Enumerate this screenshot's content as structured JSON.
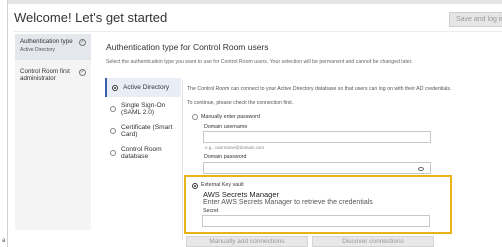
{
  "page": {
    "title": "Welcome! Let's get started",
    "save_button_label": "Save and log in",
    "corner_mark": "a"
  },
  "steps": [
    {
      "label": "Authentication type",
      "sublabel": "Active Directory",
      "check": "✓"
    },
    {
      "label": "Control Room first administrator",
      "sublabel": "",
      "check": "✓"
    }
  ],
  "section": {
    "title": "Authentication type for Control Room users",
    "description": "Select the authentication type you want to use for Control Room users. Your selection will be permanent and cannot be changed later."
  },
  "auth_options": [
    {
      "label": "Active Directory"
    },
    {
      "label": "Single Sign-On (SAML 2.0)"
    },
    {
      "label": "Certificate (Smart Card)"
    },
    {
      "label": "Control Room database"
    }
  ],
  "ad": {
    "info": "The Control Room can connect to your Active Directory database so that users can log on with their AD credentials.",
    "check_connection": "To continue, please check the connection first.",
    "manual_password_label": "Manually enter password",
    "username_label": "Domain username",
    "username_hint": "e.g., username@domain.com",
    "password_label": "Domain password"
  },
  "vault": {
    "option_label": "External Key vault",
    "title": "AWS Secrets Manager",
    "description": "Enter AWS Secrets Manager to retrieve the credentials",
    "secret_label": "Secret",
    "accent_color": "#e8b318"
  },
  "buttons": {
    "manual_connections": "Manually add connections",
    "discover_connections": "Discover connections"
  }
}
